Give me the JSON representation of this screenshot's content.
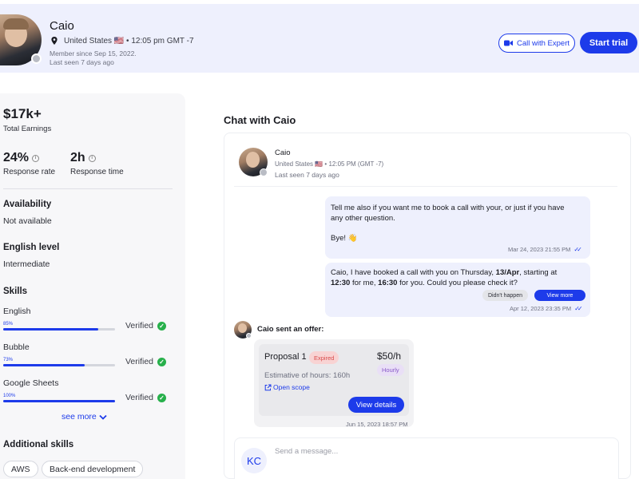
{
  "profile": {
    "name": "Caio",
    "location": "United States 🇺🇸 • 12:05 pm GMT -7",
    "member_since": "Member since Sep 15, 2022.",
    "last_seen": "Last seen 7 days ago"
  },
  "header_actions": {
    "call_label": "Call with Expert",
    "trial_label": "Start trial"
  },
  "stats": {
    "earnings_value": "$17k+",
    "earnings_label": "Total Earnings",
    "response_rate_value": "24%",
    "response_rate_label": "Response rate",
    "response_time_value": "2h",
    "response_time_label": "Response time"
  },
  "availability": {
    "title": "Availability",
    "value": "Not available"
  },
  "english": {
    "title": "English level",
    "value": "Intermediate"
  },
  "skills": {
    "title": "Skills",
    "items": [
      {
        "name": "English",
        "percent_label": "85%",
        "percent": 85,
        "status": "Verified"
      },
      {
        "name": "Bubble",
        "percent_label": "73%",
        "percent": 73,
        "status": "Verified"
      },
      {
        "name": "Google Sheets",
        "percent_label": "100%",
        "percent": 100,
        "status": "Verified"
      }
    ],
    "see_more": "see more"
  },
  "additional_skills": {
    "title": "Additional skills",
    "tags": [
      "AWS",
      "Back-end development"
    ]
  },
  "chat": {
    "title": "Chat with Caio",
    "contact": {
      "name": "Caio",
      "location": "United States 🇺🇸 • 12:05 PM (GMT -7)",
      "last_seen": "Last seen 7 days ago"
    },
    "messages": [
      {
        "line1": "Tell me also if you want me to book a call with your, or just if you have",
        "line2": "any other question.",
        "line3": "Bye! 👋",
        "time": "Mar 24, 2023 21:55 PM"
      },
      {
        "part1": "Caio, I have booked a call with you on Thursday, ",
        "bold1": "13/Apr",
        "part2": ", starting at",
        "bold2": "12:30",
        "part3": " for me, ",
        "bold3": "16:30",
        "part4": " for you. Could you please check it?",
        "btn_no": "Didn't happen",
        "btn_more": "View more",
        "time": "Apr 12, 2023 23:35 PM"
      }
    ],
    "offer": {
      "sender_text": "Caio sent an offer:",
      "title": "Proposal 1",
      "status": "Expired",
      "price": "$50/h",
      "rate_type": "Hourly",
      "hours": "Estimative of hours: 160h",
      "open_scope": "Open scope",
      "details_button": "View details",
      "time": "Jun 15, 2023 18:57 PM"
    },
    "composer": {
      "initials": "KC",
      "placeholder": "Send a message..."
    }
  },
  "colors": {
    "accent": "#1d3bea",
    "header_bg": "#eef0fd",
    "verified": "#27b04b",
    "expired_bg": "#f8d3d3",
    "hourly_bg": "#e9dff6"
  },
  "icons": [
    "map-pin-icon",
    "video-camera-icon",
    "info-icon",
    "check-circle-icon",
    "chevron-down-icon",
    "double-check-icon",
    "external-link-icon"
  ]
}
